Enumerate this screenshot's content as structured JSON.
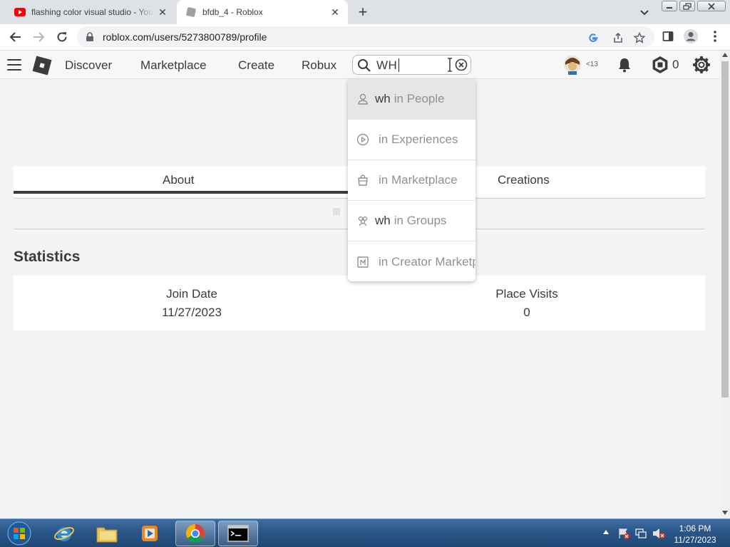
{
  "browser": {
    "tabs": [
      {
        "title": "flashing color visual studio - YouTube",
        "icon": "youtube-icon",
        "active": false
      },
      {
        "title": "bfdb_4 - Roblox",
        "icon": "roblox-page-icon",
        "active": true
      }
    ],
    "url": "roblox.com/users/5273800789/profile"
  },
  "header": {
    "nav": [
      "Discover",
      "Marketplace",
      "Create",
      "Robux"
    ],
    "search_value": "WH",
    "age_badge": "<13",
    "robux_balance": "0"
  },
  "dropdown": {
    "items": [
      {
        "query": "wh",
        "location": "in People",
        "icon": "person-icon"
      },
      {
        "query": "",
        "location": "in Experiences",
        "icon": "play-icon"
      },
      {
        "query": "",
        "location": "in Marketplace",
        "icon": "shopping-bag-icon"
      },
      {
        "query": "wh",
        "location": "in Groups",
        "icon": "groups-icon"
      },
      {
        "query": "",
        "location": "in Creator Marketplace",
        "icon": "creator-store-icon"
      }
    ]
  },
  "profile": {
    "tabs": [
      "About",
      "Creations"
    ],
    "statistics_title": "Statistics",
    "stats": [
      {
        "label": "Join Date",
        "value": "11/27/2023"
      },
      {
        "label": "Place Visits",
        "value": "0"
      }
    ]
  },
  "taskbar": {
    "time": "1:06 PM",
    "date": "11/27/2023"
  },
  "colors": {
    "page_bg": "#f2f4f5",
    "text": "#393b3d",
    "taskbar": "#2a5687"
  }
}
